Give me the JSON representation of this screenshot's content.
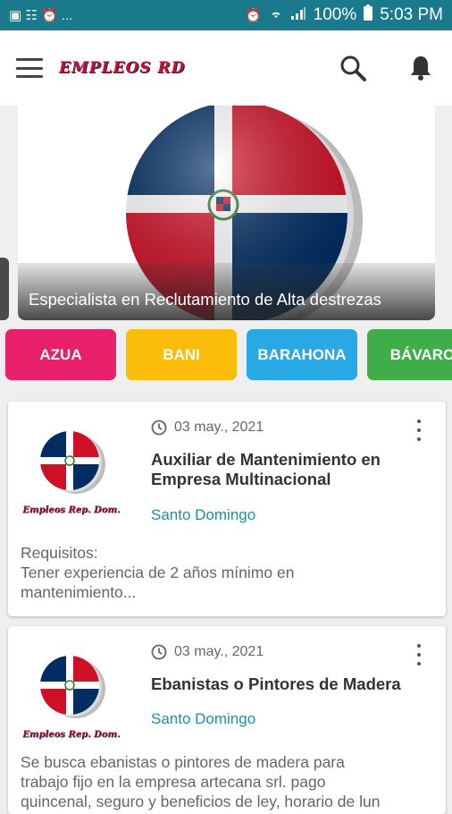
{
  "status_bar": {
    "left_glyphs": "▣ ☷ ⏰ ...",
    "battery": "100%",
    "time": "5:03 PM"
  },
  "app_bar": {
    "brand": "EMPLEOS RD",
    "menu_icon": "hamburger-menu-icon",
    "search_icon": "search-icon",
    "notification_icon": "bell-icon"
  },
  "hero": {
    "caption": "Especialista en Reclutamiento de Alta destrezas"
  },
  "categories": [
    {
      "label": "AZUA",
      "color": "#e8206a"
    },
    {
      "label": "BANI",
      "color": "#fbbd0a"
    },
    {
      "label": "BARAHONA",
      "color": "#29a8e6"
    },
    {
      "label": "BÁVARO",
      "color": "#3fae49"
    }
  ],
  "jobs": [
    {
      "date": "03 may., 2021",
      "title_line1": "Auxiliar de Mantenimiento en",
      "title_line2": "Empresa Multinacional",
      "location": "Santo Domingo",
      "desc_line1": "Requisitos:",
      "desc_line2": "Tener experiencia de 2 años mínimo en",
      "desc_line3": "mantenimiento...",
      "logo_text": "Empleos Rep. Dom."
    },
    {
      "date": "03 may., 2021",
      "title_line1": "Ebanistas o Pintores de Madera",
      "title_line2": "",
      "location": "Santo Domingo",
      "desc_line1": "Se busca ebanistas o pintores de madera para",
      "desc_line2": "trabajo fijo en la empresa artecana srl. pago",
      "desc_line3": "quincenal, seguro y beneficios de ley, horario de lun",
      "logo_text": "Empleos Rep. Dom."
    }
  ]
}
